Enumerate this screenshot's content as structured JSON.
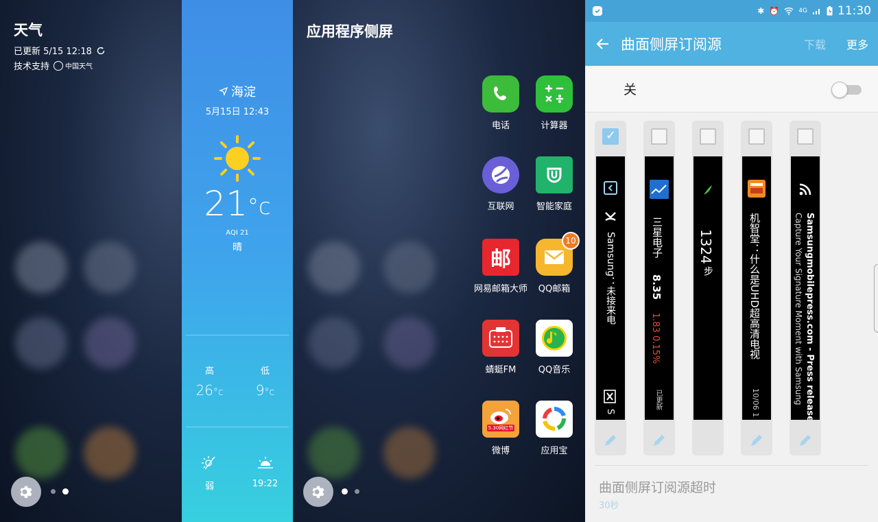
{
  "weather": {
    "title": "天气",
    "updated": "已更新 5/15 12:18",
    "support_label": "技术支持",
    "provider_logo_text": "中国天气",
    "location": "海淀",
    "datetime": "5月15日 12:43",
    "temperature": "21",
    "temp_unit": "°c",
    "aqi": "AQI 21",
    "condition": "晴",
    "high_label": "高",
    "low_label": "低",
    "high_value": "26",
    "low_value": "9",
    "unit_c": "°c",
    "uv_value": "弱",
    "sunset_time": "19:22"
  },
  "apps_edge": {
    "title": "应用程序侧屏",
    "apps": [
      {
        "label": "电话",
        "icon": "phone-icon",
        "color": "#3dbb3a"
      },
      {
        "label": "计算器",
        "icon": "calculator-icon",
        "color": "#2fbf3b"
      },
      {
        "label": "互联网",
        "icon": "internet-icon",
        "color": "#6a5fd6"
      },
      {
        "label": "智能家庭",
        "icon": "smart-home-icon",
        "color": "#21b36b"
      },
      {
        "label": "网易邮箱大师",
        "icon": "netease-mail-icon",
        "color": "#e8262e"
      },
      {
        "label": "QQ邮箱",
        "icon": "qq-mail-icon",
        "color": "#f6b62d",
        "badge": "10"
      },
      {
        "label": "蜻蜓FM",
        "icon": "radio-icon",
        "color": "#e33434"
      },
      {
        "label": "QQ音乐",
        "icon": "qq-music-icon",
        "color": "#ffffff"
      },
      {
        "label": "微博",
        "icon": "weibo-icon",
        "color": "#f4a23a",
        "tag": "5.30网红节"
      },
      {
        "label": "应用宝",
        "icon": "app-store-icon",
        "color": "#ffffff"
      }
    ]
  },
  "settings": {
    "status_time": "11:30",
    "network": "4G",
    "title": "曲面侧屏订阅源",
    "download_label": "下载",
    "more_label": "更多",
    "switch_label": "关",
    "timeout_title": "曲面侧屏订阅源超时",
    "timeout_value": "30秒",
    "feeds": [
      {
        "checked": true,
        "line1": "Samsung：未接来电",
        "line2": "S"
      },
      {
        "checked": false,
        "line1": "三星电子",
        "value": "8.35",
        "change": "1.83  0.15%",
        "footer": "已更新"
      },
      {
        "checked": false,
        "line1": "1324",
        "unit": "步"
      },
      {
        "checked": false,
        "line1": "机智堂：什么是UHD超高清电视",
        "footer": "10/06 1"
      },
      {
        "checked": false,
        "line1": "Samsungmobilepress.com - Press release",
        "line2": "Capture Your Signature Moment with Samsung"
      }
    ]
  },
  "colors": {
    "statusbar": "#46a3d8",
    "appbar": "#4fb2e1",
    "weather_top": "#3f8ee6",
    "weather_bottom": "#36d0df",
    "stock_down": "#e8503a"
  }
}
